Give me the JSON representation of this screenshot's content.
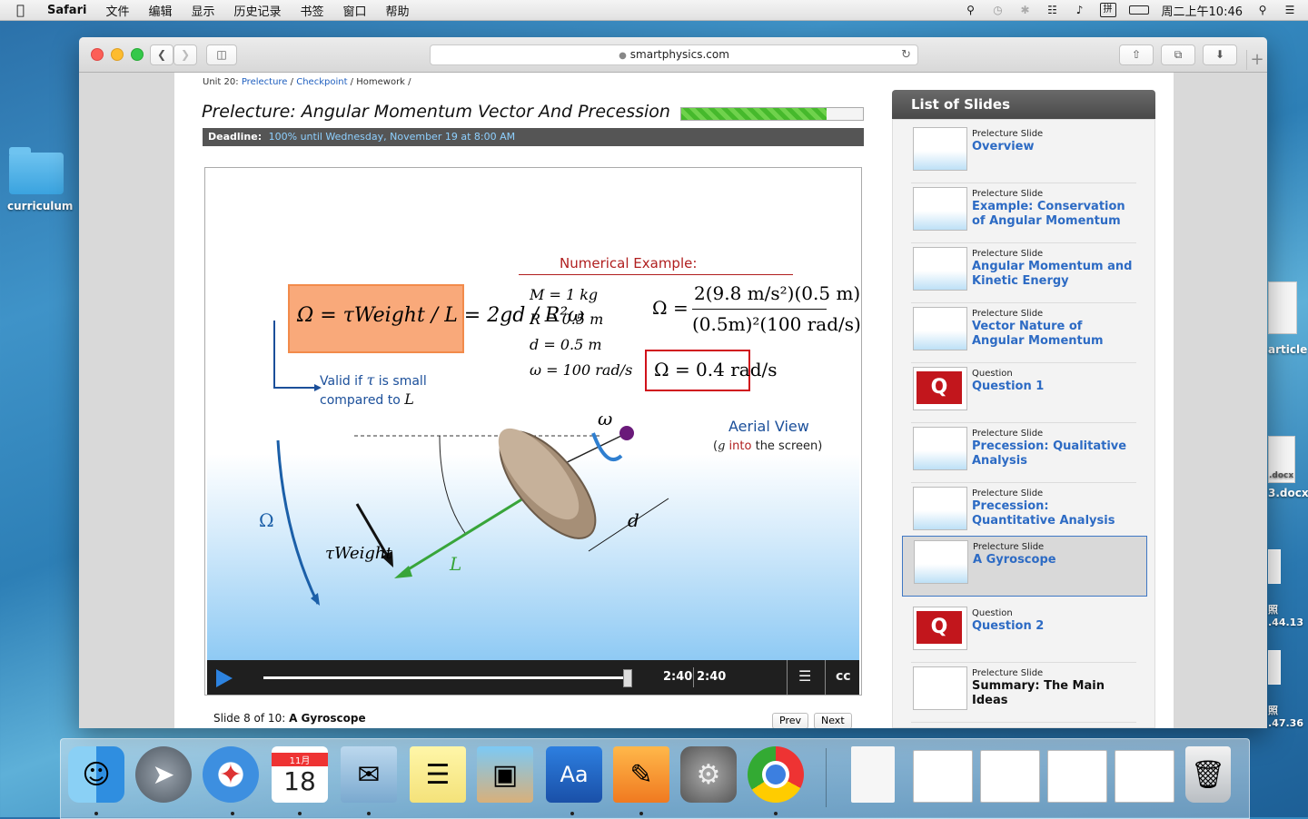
{
  "menubar": {
    "app": "Safari",
    "items": [
      "文件",
      "编辑",
      "显示",
      "历史记录",
      "书签",
      "窗口",
      "帮助"
    ],
    "clock": "周二上午10:46"
  },
  "desktop": {
    "folder_label": "curriculum",
    "file_labels": [
      "article",
      ".docx",
      "3.docx",
      "照",
      ".44.13",
      "照",
      ".47.36"
    ]
  },
  "browser": {
    "url": "smartphysics.com"
  },
  "page": {
    "breadcrumb": {
      "prefix": "Unit 20:",
      "link1": "Prelecture",
      "sep": "/",
      "link2": "Checkpoint",
      "current": "Homework",
      "trail": "/"
    },
    "title": "Prelecture: Angular Momentum Vector And Precession",
    "progress_fraction": 0.8,
    "deadline_label": "Deadline:",
    "deadline_value": "100% until Wednesday, November 19 at 8:00 AM"
  },
  "slide": {
    "numerical_example": "Numerical Example:",
    "formula_main": "Ω = τWeight / L = 2gd / R²ω",
    "valid_if": "Valid if",
    "tau_symbol": "τ",
    "is_small": "is small",
    "compared_to": "compared to",
    "L_symbol": "L",
    "givens": [
      "M = 1 kg",
      "R = 0.5 m",
      "d = 0.5 m",
      "ω = 100 rad/s"
    ],
    "result": "Ω = 0.4 rad/s",
    "aerial_view": "Aerial View",
    "into_screen_g": "g",
    "into_screen_into": "into",
    "into_screen_rest": "the screen)",
    "label_omega_top": "ω",
    "label_Omega": "Ω",
    "label_tau": "τWeight",
    "label_L": "L",
    "label_d": "d"
  },
  "video": {
    "progress_fraction": 1.0,
    "current_time": "2:40",
    "total_time": "2:40",
    "transcript_icon": "transcript-icon",
    "cc_label": "cc"
  },
  "footer": {
    "slide_text": "Slide 8 of 10:",
    "slide_name": "A Gyroscope",
    "prev": "Prev",
    "next": "Next"
  },
  "sidebar": {
    "title": "List of Slides",
    "items": [
      {
        "kind": "Prelecture Slide",
        "name": "Overview",
        "type": "slide"
      },
      {
        "kind": "Prelecture Slide",
        "name": "Example: Conservation of Angular Momentum",
        "type": "slide"
      },
      {
        "kind": "Prelecture Slide",
        "name": "Angular Momentum and Kinetic Energy",
        "type": "slide"
      },
      {
        "kind": "Prelecture Slide",
        "name": "Vector Nature of Angular Momentum",
        "type": "slide"
      },
      {
        "kind": "Question",
        "name": "Question 1",
        "type": "question"
      },
      {
        "kind": "Prelecture Slide",
        "name": "Precession: Qualitative Analysis",
        "type": "slide"
      },
      {
        "kind": "Prelecture Slide",
        "name": "Precession: Quantitative Analysis",
        "type": "slide"
      },
      {
        "kind": "Prelecture Slide",
        "name": "A Gyroscope",
        "type": "slide",
        "active": true
      },
      {
        "kind": "Question",
        "name": "Question 2",
        "type": "question"
      },
      {
        "kind": "Prelecture Slide",
        "name": "Summary: The Main Ideas",
        "type": "slide"
      }
    ]
  },
  "dock": {
    "calendar_month": "11月",
    "calendar_day": "18",
    "items": [
      "finder-icon",
      "launchpad-icon",
      "safari-icon",
      "calendar-icon",
      "mail-icon",
      "notes-icon",
      "preview-icon",
      "dictionary-icon",
      "pages-icon",
      "system-preferences-icon",
      "chrome-icon",
      "document-icon",
      "screenshot-1",
      "screenshot-2",
      "screenshot-3",
      "screenshot-4",
      "trash-icon"
    ]
  }
}
